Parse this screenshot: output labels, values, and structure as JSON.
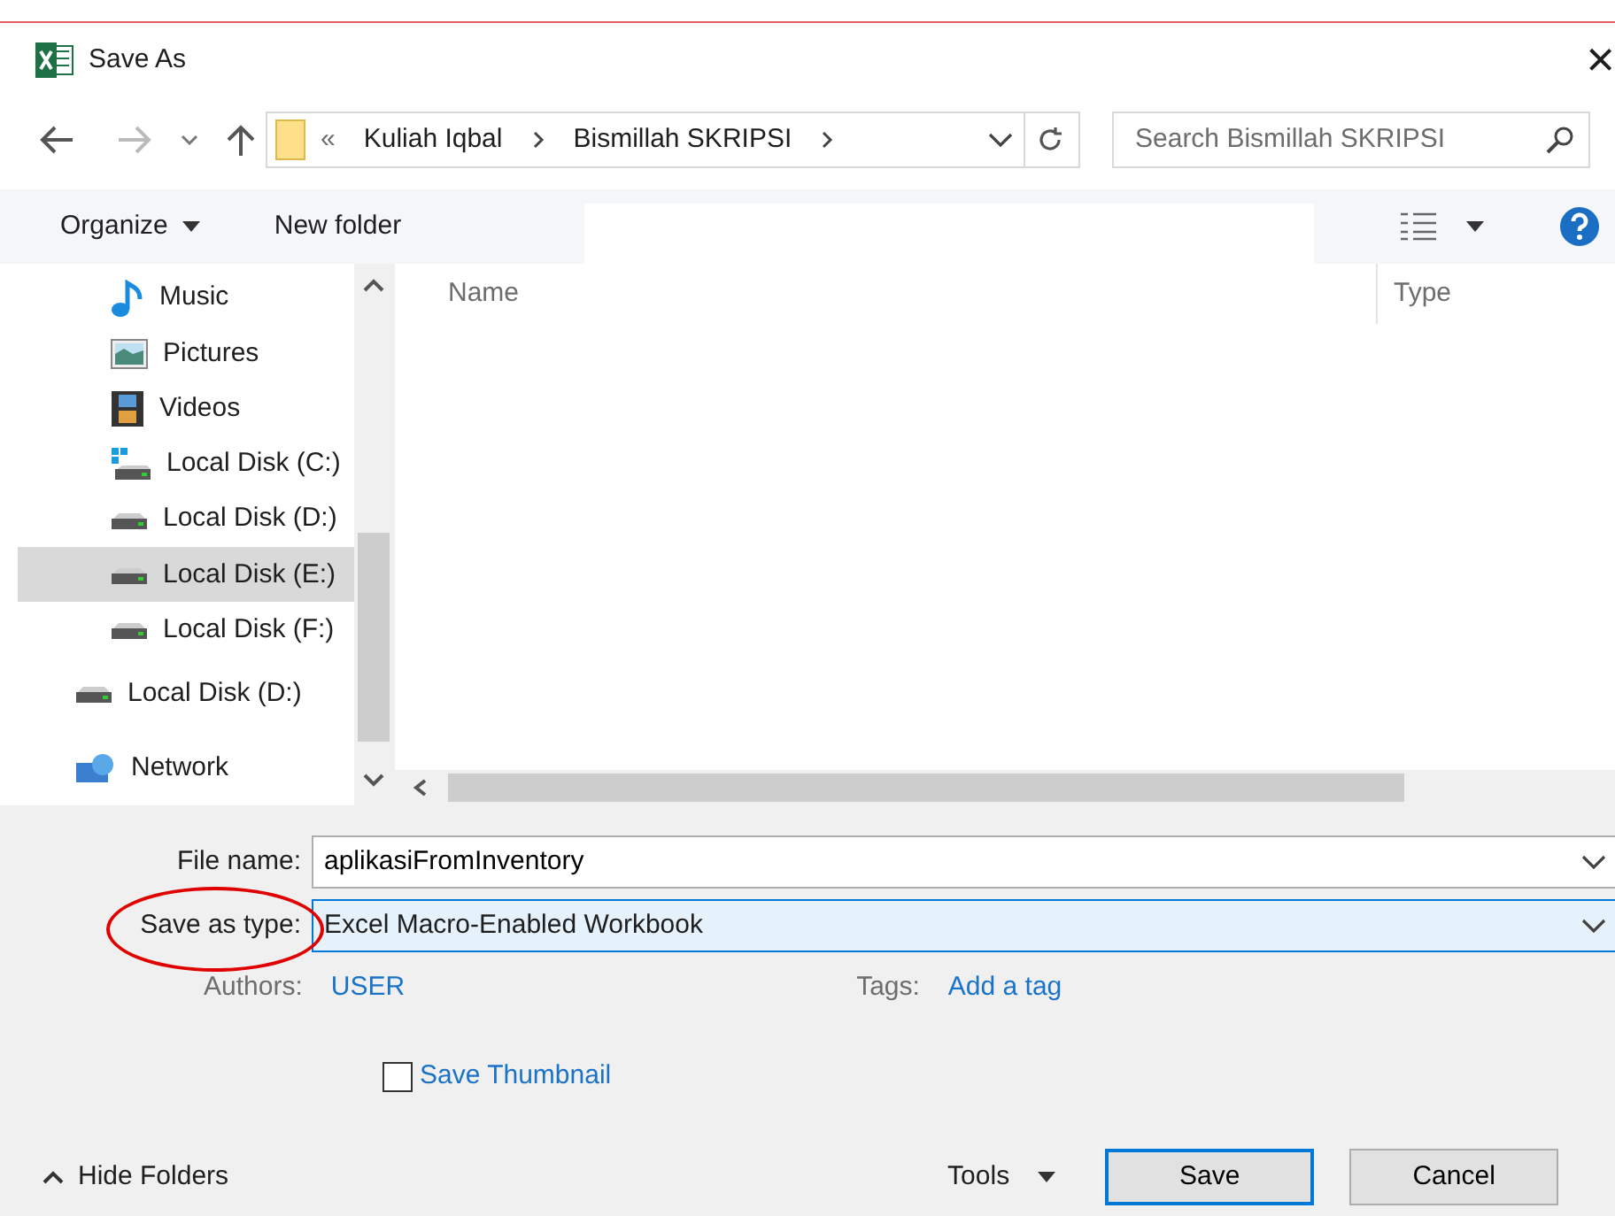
{
  "window": {
    "title": "Save As",
    "close": "×"
  },
  "nav": {
    "breadcrumb_prefix": "«",
    "path": [
      {
        "label": "Kuliah Iqbal"
      },
      {
        "label": "Bismillah SKRIPSI"
      }
    ],
    "search": {
      "placeholder": "Search Bismillah SKRIPSI"
    }
  },
  "toolbar": {
    "organize": "Organize",
    "new_folder": "New folder"
  },
  "sidebar": {
    "nested_items": [
      {
        "label": "Music",
        "kind": "music",
        "selected": false
      },
      {
        "label": "Pictures",
        "kind": "pictures",
        "selected": false
      },
      {
        "label": "Videos",
        "kind": "videos",
        "selected": false
      },
      {
        "label": "Local Disk (C:)",
        "kind": "system-disk",
        "selected": false
      },
      {
        "label": "Local Disk (D:)",
        "kind": "disk",
        "selected": false
      },
      {
        "label": "Local Disk (E:)",
        "kind": "disk",
        "selected": true
      },
      {
        "label": "Local Disk (F:)",
        "kind": "disk",
        "selected": false
      }
    ],
    "items": [
      {
        "label": "Local Disk (D:)",
        "kind": "disk",
        "selected": false
      },
      {
        "label": "Network",
        "kind": "network",
        "selected": false
      }
    ]
  },
  "file_list": {
    "columns": [
      "Name",
      "Type"
    ]
  },
  "form": {
    "file_name_label": "File name:",
    "file_name": "aplikasiFromInventory",
    "type_label": "Save as type:",
    "type_value": "Excel Macro-Enabled Workbook",
    "authors_label": "Authors:",
    "authors": "USER",
    "tags_label": "Tags:",
    "tags": "Add a tag",
    "thumbnail": {
      "label": "Save Thumbnail",
      "checked": false
    }
  },
  "footer": {
    "hide_folders": "Hide Folders",
    "tools": "Tools",
    "save": "Save",
    "cancel": "Cancel"
  }
}
